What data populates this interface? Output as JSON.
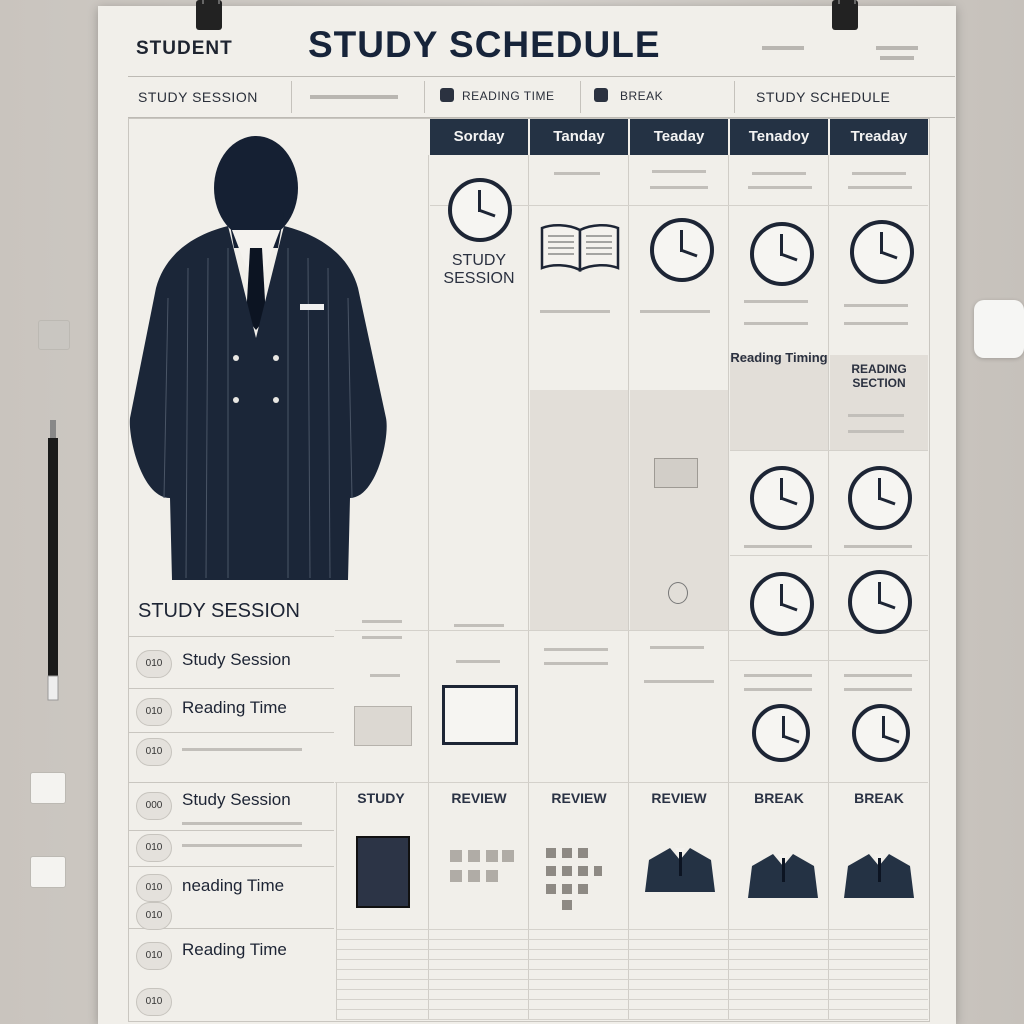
{
  "header": {
    "student_label": "STUDENT",
    "title": "STUDY SCHEDULE"
  },
  "subheader": {
    "item1": "STUDY SESSION",
    "item2": "READING TIME",
    "item3": "BREAK",
    "item4": "STUDY SCHEDULE"
  },
  "days": [
    "Sorday",
    "Tanday",
    "Teaday",
    "Tenadoy",
    "Treaday"
  ],
  "sidebar": {
    "section_title": "STUDY SESSION",
    "items": [
      {
        "badge": "010",
        "label": "Study Session"
      },
      {
        "badge": "010",
        "label": "Reading Time"
      },
      {
        "badge": "010",
        "label": ""
      },
      {
        "badge": "000",
        "label": "Study Session"
      },
      {
        "badge": "010",
        "label": ""
      },
      {
        "badge": "010",
        "label": "neading Time"
      },
      {
        "badge": "010",
        "label": ""
      },
      {
        "badge": "010",
        "label": "Reading Time"
      },
      {
        "badge": "010",
        "label": ""
      }
    ]
  },
  "cells": {
    "study_session": "STUDY SESSION",
    "reading_time_1": "Reading Timing",
    "reading_time_2": "READING SECTION"
  },
  "bottom_row": [
    "STUDY",
    "REVIEW",
    "REVIEW",
    "REVIEW",
    "BREAK",
    "BREAK"
  ],
  "colors": {
    "navy": "#243244",
    "paper": "#f1efea",
    "wall": "#cbc6c0"
  },
  "icons": [
    "clock-icon",
    "book-icon",
    "person-silhouette",
    "jacket-icon",
    "pen-icon",
    "magnet-icon",
    "binder-clip-icon"
  ]
}
